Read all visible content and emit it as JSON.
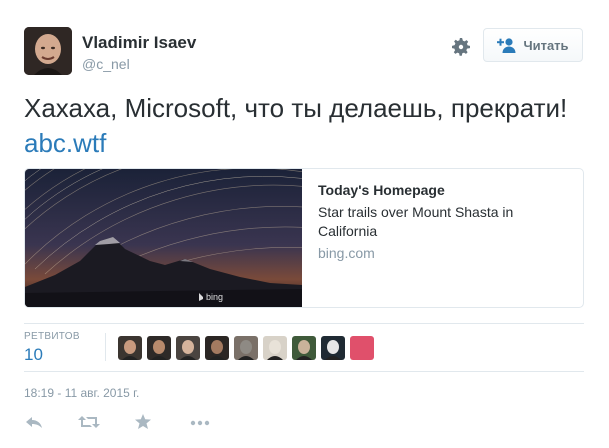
{
  "author": {
    "name": "Vladimir Isaev",
    "handle": "@c_nel",
    "avatar_icon": "user-avatar"
  },
  "follow_button": {
    "label": "Читать",
    "icon": "follow-plus-user-icon"
  },
  "settings_icon": "gear-icon",
  "tweet": {
    "text": "Хахаха, Microsoft, что ты делаешь, прекрати! ",
    "link": "abc.wtf"
  },
  "card": {
    "title": "Today's Homepage",
    "description": "Star trails over Mount Shasta in California",
    "domain": "bing.com",
    "image_watermark": "bing"
  },
  "stats": {
    "retweets_label": "РЕТВИТОВ",
    "retweets_count": "10",
    "retweeter_avatars": 9
  },
  "timestamp": "18:19 - 11 авг. 2015 г.",
  "actions": [
    "reply-icon",
    "retweet-icon",
    "favorite-star-icon",
    "more-dots-icon"
  ],
  "colors": {
    "link": "#2b7bb9",
    "muted": "#8899a6",
    "border": "#e1e8ed",
    "text": "#292f33"
  }
}
